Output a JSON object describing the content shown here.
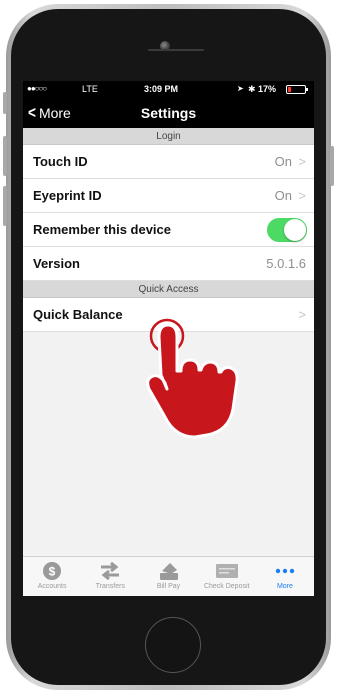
{
  "status_bar": {
    "signal": "●●○○○",
    "carrier": "LTE",
    "time": "3:09 PM",
    "location_icon": "location-arrow-icon",
    "bluetooth_icon": "bluetooth-icon",
    "battery_percent": "17%",
    "battery_level": 0.17
  },
  "nav": {
    "back_label": "More",
    "title": "Settings"
  },
  "sections": {
    "login": {
      "header": "Login",
      "rows": {
        "touch_id": {
          "label": "Touch ID",
          "value": "On"
        },
        "eyeprint_id": {
          "label": "Eyeprint ID",
          "value": "On"
        },
        "remember": {
          "label": "Remember this device",
          "toggle_on": true
        },
        "version": {
          "label": "Version",
          "value": "5.0.1.6"
        }
      }
    },
    "quick_access": {
      "header": "Quick Access",
      "rows": {
        "quick_balance": {
          "label": "Quick Balance"
        }
      }
    }
  },
  "tabs": [
    {
      "label": "Accounts",
      "icon": "dollar-circle-icon"
    },
    {
      "label": "Transfers",
      "icon": "transfer-arrows-icon"
    },
    {
      "label": "Bill Pay",
      "icon": "bill-pay-icon"
    },
    {
      "label": "Check Deposit",
      "icon": "check-icon"
    },
    {
      "label": "More",
      "icon": "more-dots-icon"
    }
  ],
  "colors": {
    "accent": "#1e7cf2",
    "toggle_on": "#4cd964",
    "hand": "#c8161d",
    "battery_low": "#ff3b30"
  }
}
